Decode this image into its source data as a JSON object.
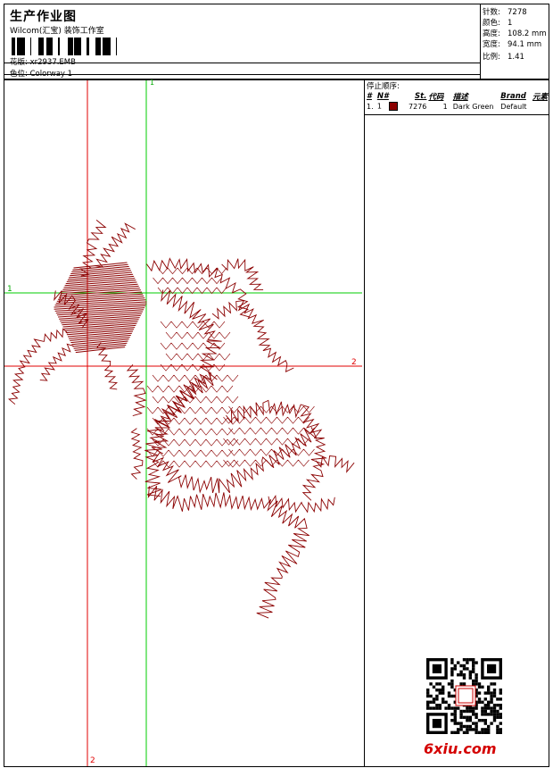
{
  "header": {
    "title": "生产作业图",
    "subtitle": "Wilcom(汇宝) 装饰工作室",
    "design_label": "花版:",
    "design_value": "xr2937.EMB",
    "color_label": "色位:",
    "color_value": "Colorway 1"
  },
  "specs": [
    {
      "label": "针数:",
      "value": "7278"
    },
    {
      "label": "颜色:",
      "value": "1"
    },
    {
      "label": "高度:",
      "value": "108.2 mm"
    },
    {
      "label": "宽度:",
      "value": "94.1 mm"
    },
    {
      "label": "比例:",
      "value": "1.41"
    }
  ],
  "stop_sequence": {
    "heading": "停止顺序:",
    "columns": [
      "#",
      "N#",
      "St.",
      "代码",
      "描述",
      "Brand",
      "元素"
    ],
    "rows": [
      {
        "index": "1.",
        "needle": "1",
        "swatch_color": "#8B0000",
        "stitches": "7276",
        "code": "1",
        "description": "Dark Green",
        "brand": "Default",
        "element": ""
      }
    ]
  },
  "guides": {
    "horizontal_1": "1",
    "horizontal_2": "2",
    "vertical_1": "1",
    "vertical_2": "2"
  },
  "watermark": "6xiu.com",
  "colors": {
    "thread": "#8B0000",
    "guide_red": "#e00000",
    "guide_green": "#00cc00",
    "watermark": "#d40000"
  }
}
